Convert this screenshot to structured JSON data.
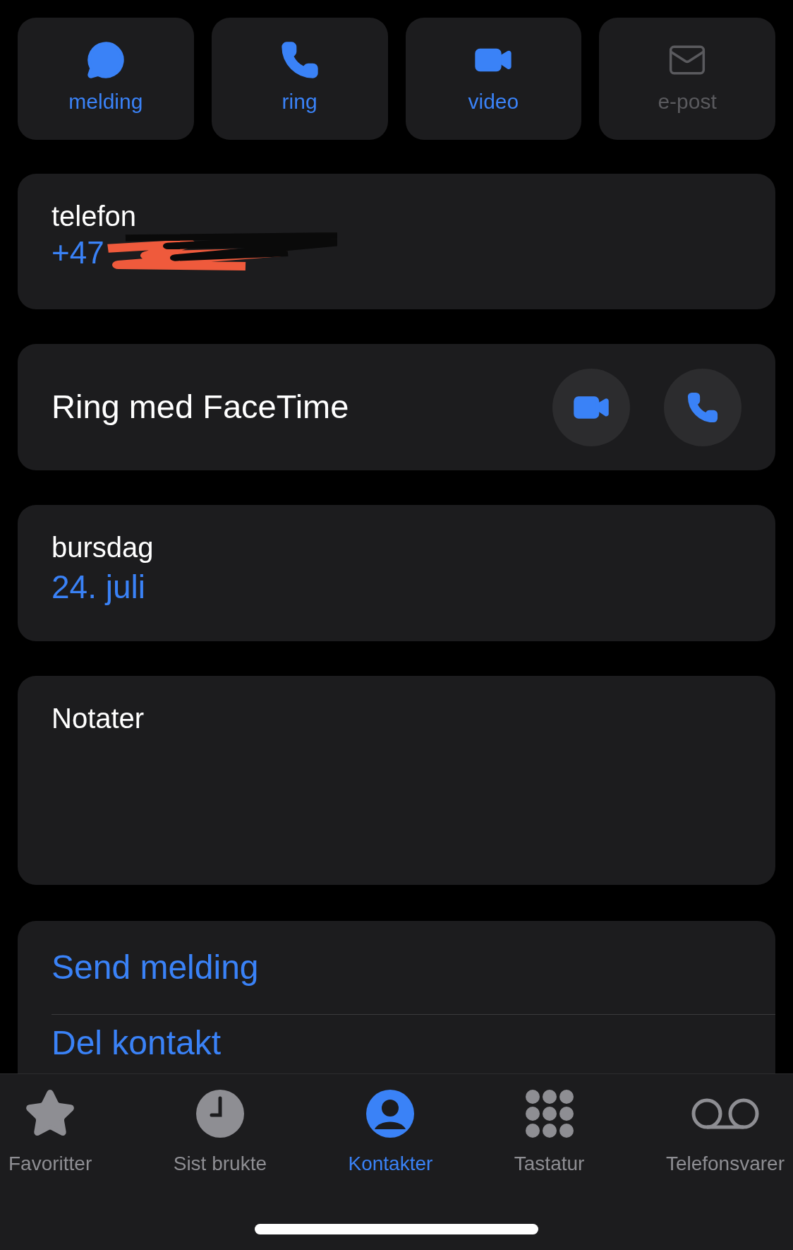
{
  "actions": [
    {
      "kind": "message",
      "label": "melding",
      "disabled": false
    },
    {
      "kind": "call",
      "label": "ring",
      "disabled": false
    },
    {
      "kind": "video",
      "label": "video",
      "disabled": false
    },
    {
      "kind": "mail",
      "label": "e-post",
      "disabled": true
    }
  ],
  "phone": {
    "label": "telefon",
    "value": "+47"
  },
  "facetime": {
    "label": "Ring med FaceTime"
  },
  "birthday": {
    "label": "bursdag",
    "value": "24. juli"
  },
  "notes": {
    "label": "Notater"
  },
  "links": [
    "Send melding",
    "Del kontakt"
  ],
  "tabs": [
    {
      "kind": "favorites",
      "label": "Favoritter",
      "selected": false
    },
    {
      "kind": "recents",
      "label": "Sist brukte",
      "selected": false
    },
    {
      "kind": "contacts",
      "label": "Kontakter",
      "selected": true
    },
    {
      "kind": "keypad",
      "label": "Tastatur",
      "selected": false
    },
    {
      "kind": "voicemail",
      "label": "Telefonsvarer",
      "selected": false
    }
  ]
}
